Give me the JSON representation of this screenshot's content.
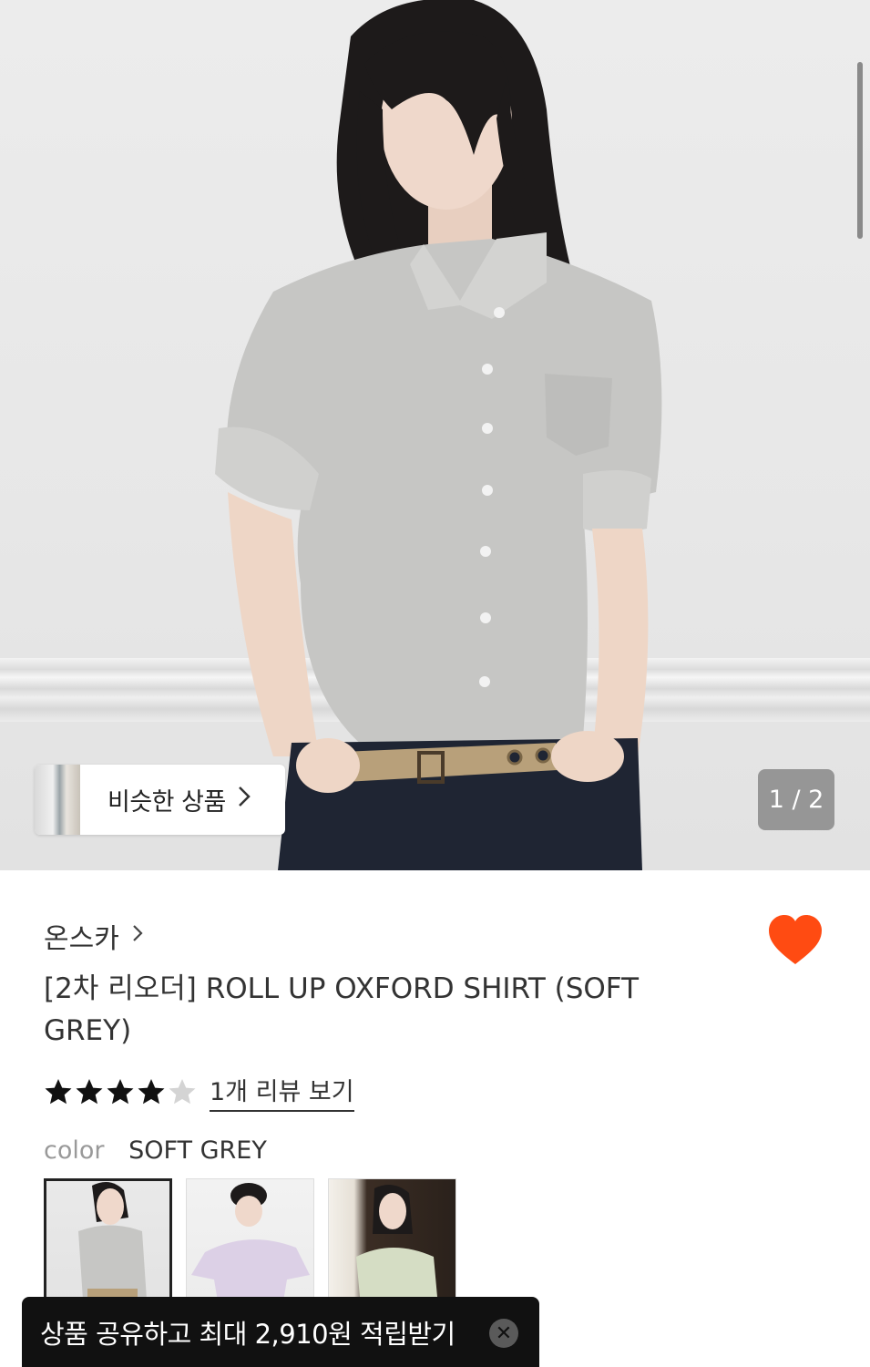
{
  "hero": {
    "similar_button_label": "비슷한 상품",
    "pager_text": "1 / 2"
  },
  "product": {
    "brand": "온스카",
    "title": "[2차 리오더] ROLL UP OXFORD SHIRT (SOFT GREY)",
    "rating": 4,
    "rating_max": 5,
    "review_link": "1개 리뷰 보기",
    "color_label": "color",
    "color_value": "SOFT GREY",
    "wishlisted": true
  },
  "color_options": [
    {
      "name": "soft-grey",
      "selected": true
    },
    {
      "name": "lavender",
      "selected": false
    },
    {
      "name": "mint",
      "selected": false
    }
  ],
  "toast": {
    "text": "상품 공유하고 최대 2,910원 적립받기"
  },
  "colors": {
    "heart": "#ff4b12",
    "star_filled": "#111111",
    "star_empty": "#d4d4d4",
    "toast_bg": "#111111"
  },
  "icons": {
    "wish": "heart-icon",
    "star": "star-icon",
    "chevron": "chevron-right-icon",
    "close": "close-icon"
  }
}
